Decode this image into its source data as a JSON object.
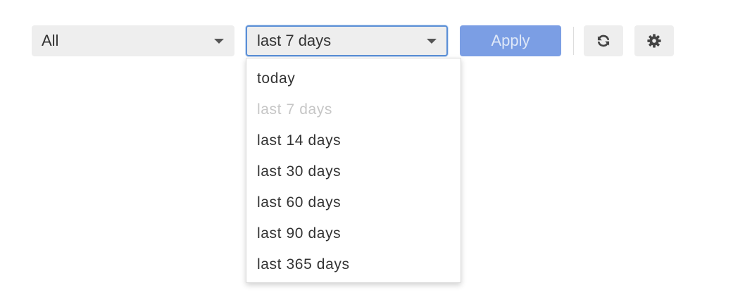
{
  "toolbar": {
    "scope_select": {
      "value": "All"
    },
    "range_select": {
      "value": "last 7 days"
    },
    "apply_label": "Apply",
    "refresh_icon": "refresh-icon",
    "settings_icon": "gear-icon"
  },
  "range_options": [
    {
      "label": "today",
      "disabled": false
    },
    {
      "label": "last 7 days",
      "disabled": true
    },
    {
      "label": "last 14 days",
      "disabled": false
    },
    {
      "label": "last 30 days",
      "disabled": false
    },
    {
      "label": "last 60 days",
      "disabled": false
    },
    {
      "label": "last 90 days",
      "disabled": false
    },
    {
      "label": "last 365 days",
      "disabled": false
    }
  ],
  "colors": {
    "select_background": "#eeeeee",
    "focus_border": "#5b8fd6",
    "apply_background": "#7b9ee4",
    "disabled_option_text": "#c6c6c6"
  }
}
